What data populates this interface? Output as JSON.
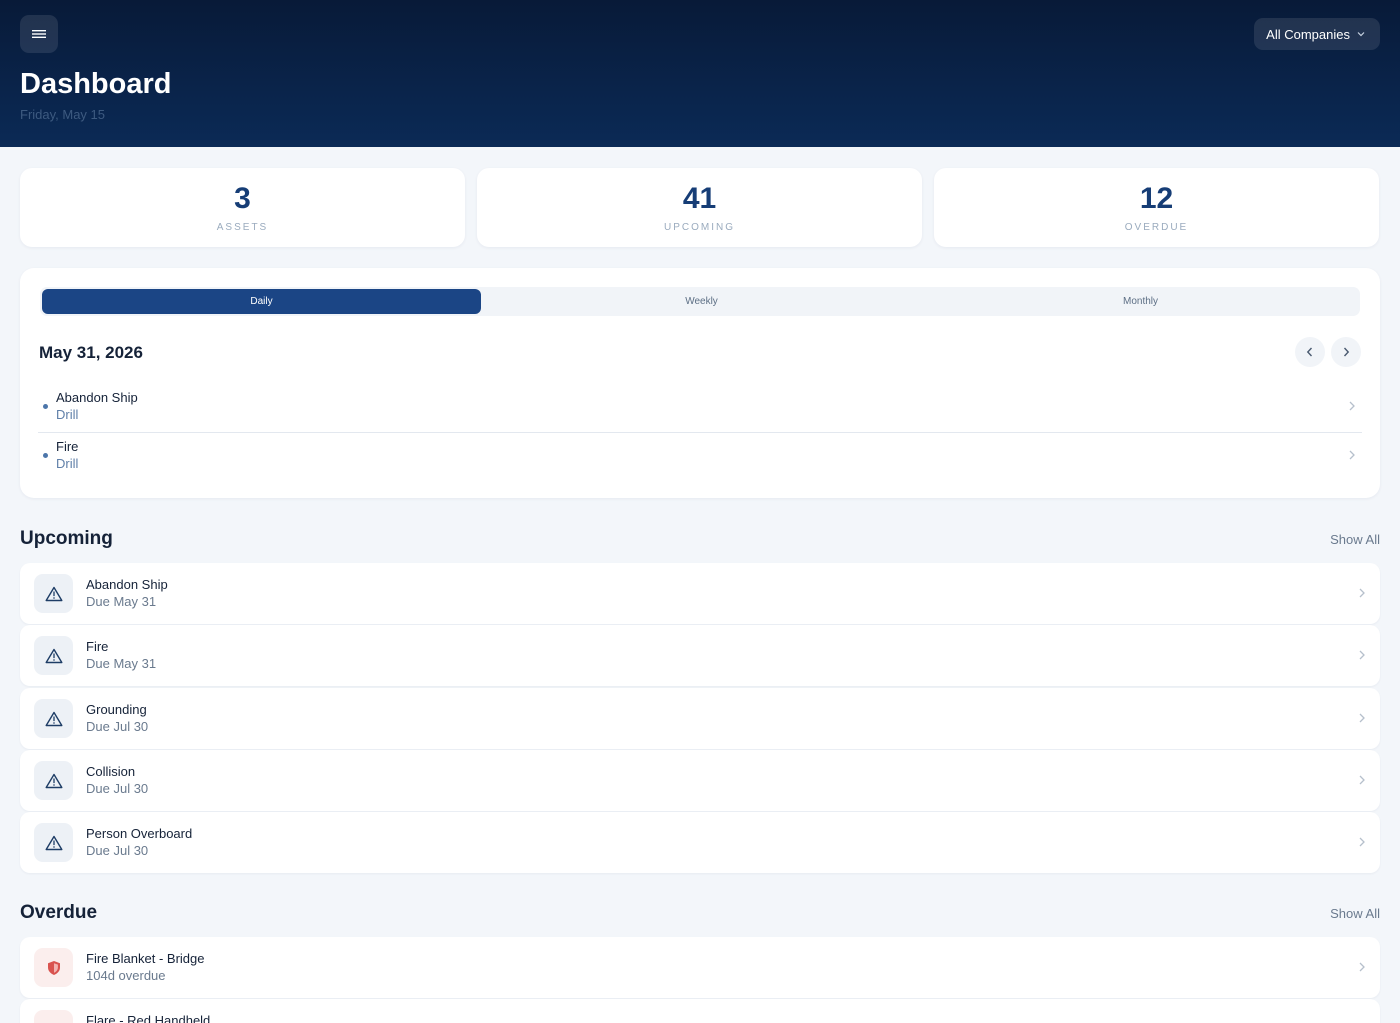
{
  "header": {
    "title": "Dashboard",
    "date": "Friday, May 15",
    "company_selector": "All Companies"
  },
  "stats": [
    {
      "value": "3",
      "label": "ASSETS"
    },
    {
      "value": "41",
      "label": "UPCOMING"
    },
    {
      "value": "12",
      "label": "OVERDUE"
    }
  ],
  "calendar": {
    "tabs": [
      {
        "label": "Daily",
        "active": true
      },
      {
        "label": "Weekly",
        "active": false
      },
      {
        "label": "Monthly",
        "active": false
      }
    ],
    "date": "May 31, 2026",
    "items": [
      {
        "title": "Abandon Ship",
        "subtitle": "Drill"
      },
      {
        "title": "Fire",
        "subtitle": "Drill"
      }
    ]
  },
  "upcoming": {
    "title": "Upcoming",
    "show_all": "Show All",
    "items": [
      {
        "title": "Abandon Ship",
        "subtitle": "Due May 31",
        "icon": "warning-triangle-icon"
      },
      {
        "title": "Fire",
        "subtitle": "Due May 31",
        "icon": "warning-triangle-icon"
      },
      {
        "title": "Grounding",
        "subtitle": "Due Jul 30",
        "icon": "warning-triangle-icon"
      },
      {
        "title": "Collision",
        "subtitle": "Due Jul 30",
        "icon": "warning-triangle-icon"
      },
      {
        "title": "Person Overboard",
        "subtitle": "Due Jul 30",
        "icon": "warning-triangle-icon"
      }
    ]
  },
  "overdue": {
    "title": "Overdue",
    "show_all": "Show All",
    "items": [
      {
        "title": "Fire Blanket - Bridge",
        "subtitle": "104d overdue",
        "icon": "shield-icon"
      },
      {
        "title": "Flare - Red Handheld",
        "subtitle": "",
        "icon": "shield-icon"
      }
    ]
  },
  "colors": {
    "header_top": "#081a38",
    "header_bottom": "#0b2a56",
    "accent": "#1b4585",
    "stat_value": "#163d76",
    "overdue_icon": "#d9534f"
  }
}
